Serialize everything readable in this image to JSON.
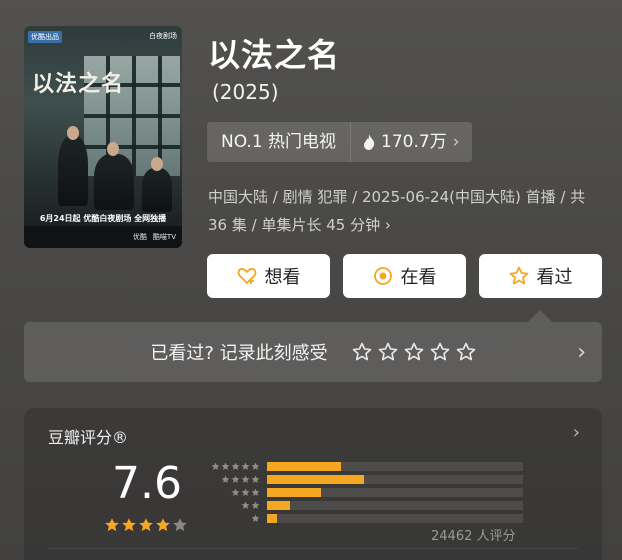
{
  "poster": {
    "badge": "优酷出品",
    "logo": "白夜剧场",
    "title_art": "以法之名",
    "date_line": "6月24日起 优酷白夜剧场 全网独播",
    "platforms": [
      "优酷",
      "酷喵TV"
    ]
  },
  "title": "以法之名",
  "year": "(2025)",
  "rank": "NO.1 热门电视",
  "heat": {
    "value": "170.7万",
    "chevron": "›"
  },
  "meta": {
    "text": "中国大陆 / 剧情 犯罪 / 2025-06-24(中国大陆) 首播 / 共 36 集 / 单集片长 45 分钟",
    "chevron": "›"
  },
  "actions": [
    {
      "label": "想看",
      "icon": "heart-plus-icon"
    },
    {
      "label": "在看",
      "icon": "target-icon"
    },
    {
      "label": "看过",
      "icon": "star-icon"
    }
  ],
  "record": {
    "label": "已看过? 记录此刻感受",
    "star_count": 5,
    "chevron": "›"
  },
  "rating": {
    "source": "豆瓣评分®",
    "chevron": "›",
    "score": "7.6",
    "stars_filled": 4,
    "stars_total": 5,
    "distribution": [
      {
        "stars": 5,
        "fraction": 0.29
      },
      {
        "stars": 4,
        "fraction": 0.38
      },
      {
        "stars": 3,
        "fraction": 0.21
      },
      {
        "stars": 2,
        "fraction": 0.09
      },
      {
        "stars": 1,
        "fraction": 0.04
      }
    ],
    "count": "24462 人评分"
  },
  "colors": {
    "accent": "#f5a623",
    "background": "#4b4a48",
    "button_bg": "#ffffff"
  }
}
